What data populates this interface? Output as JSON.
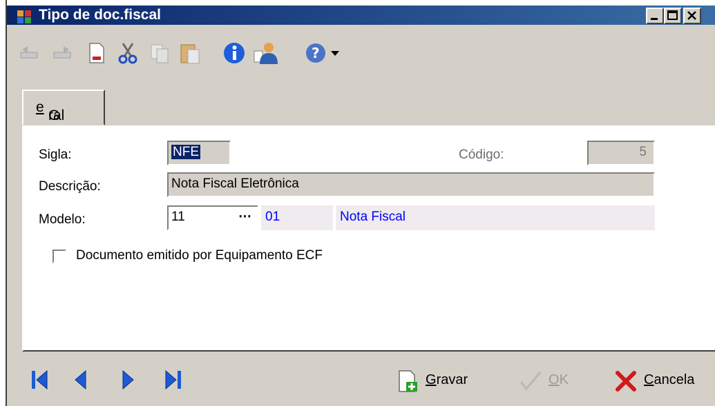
{
  "window": {
    "title": "Tipo de doc.fiscal"
  },
  "tabs": [
    {
      "label_pre": "G",
      "label_mnemonic": "e",
      "label_post": "ral"
    }
  ],
  "form": {
    "sigla_label": "Sigla:",
    "sigla_value": "NFE",
    "codigo_label": "Código:",
    "codigo_value": "5",
    "descricao_label": "Descrição:",
    "descricao_value": "Nota Fiscal Eletrônica",
    "modelo_label": "Modelo:",
    "modelo_value": "11",
    "modelo_button": "⋯",
    "modelo_code": "01",
    "modelo_desc": "Nota Fiscal",
    "ecf_checkbox_label": "Documento emitido por Equipamento ECF",
    "ecf_checked": false
  },
  "buttons": {
    "gravar_mnemonic": "G",
    "gravar_rest": "ravar",
    "ok_mnemonic": "O",
    "ok_rest": "K",
    "cancela_mnemonic": "C",
    "cancela_rest": "ancela"
  },
  "icons": {
    "toolbar": [
      "undo-icon",
      "redo-icon",
      "delete-doc-icon",
      "cut-icon",
      "copy-icon",
      "paste-icon",
      "info-icon",
      "user-icon",
      "help-icon",
      "dropdown-arrow-icon"
    ],
    "navigation": [
      "first-record-icon",
      "previous-record-icon",
      "next-record-icon",
      "last-record-icon"
    ]
  },
  "colors": {
    "titlebar_start": "#0a246a",
    "titlebar_end": "#3a6ea5",
    "nav_blue": "#1c5ad6",
    "link_blue": "#0000ff",
    "cancel_red": "#d11a1a"
  }
}
